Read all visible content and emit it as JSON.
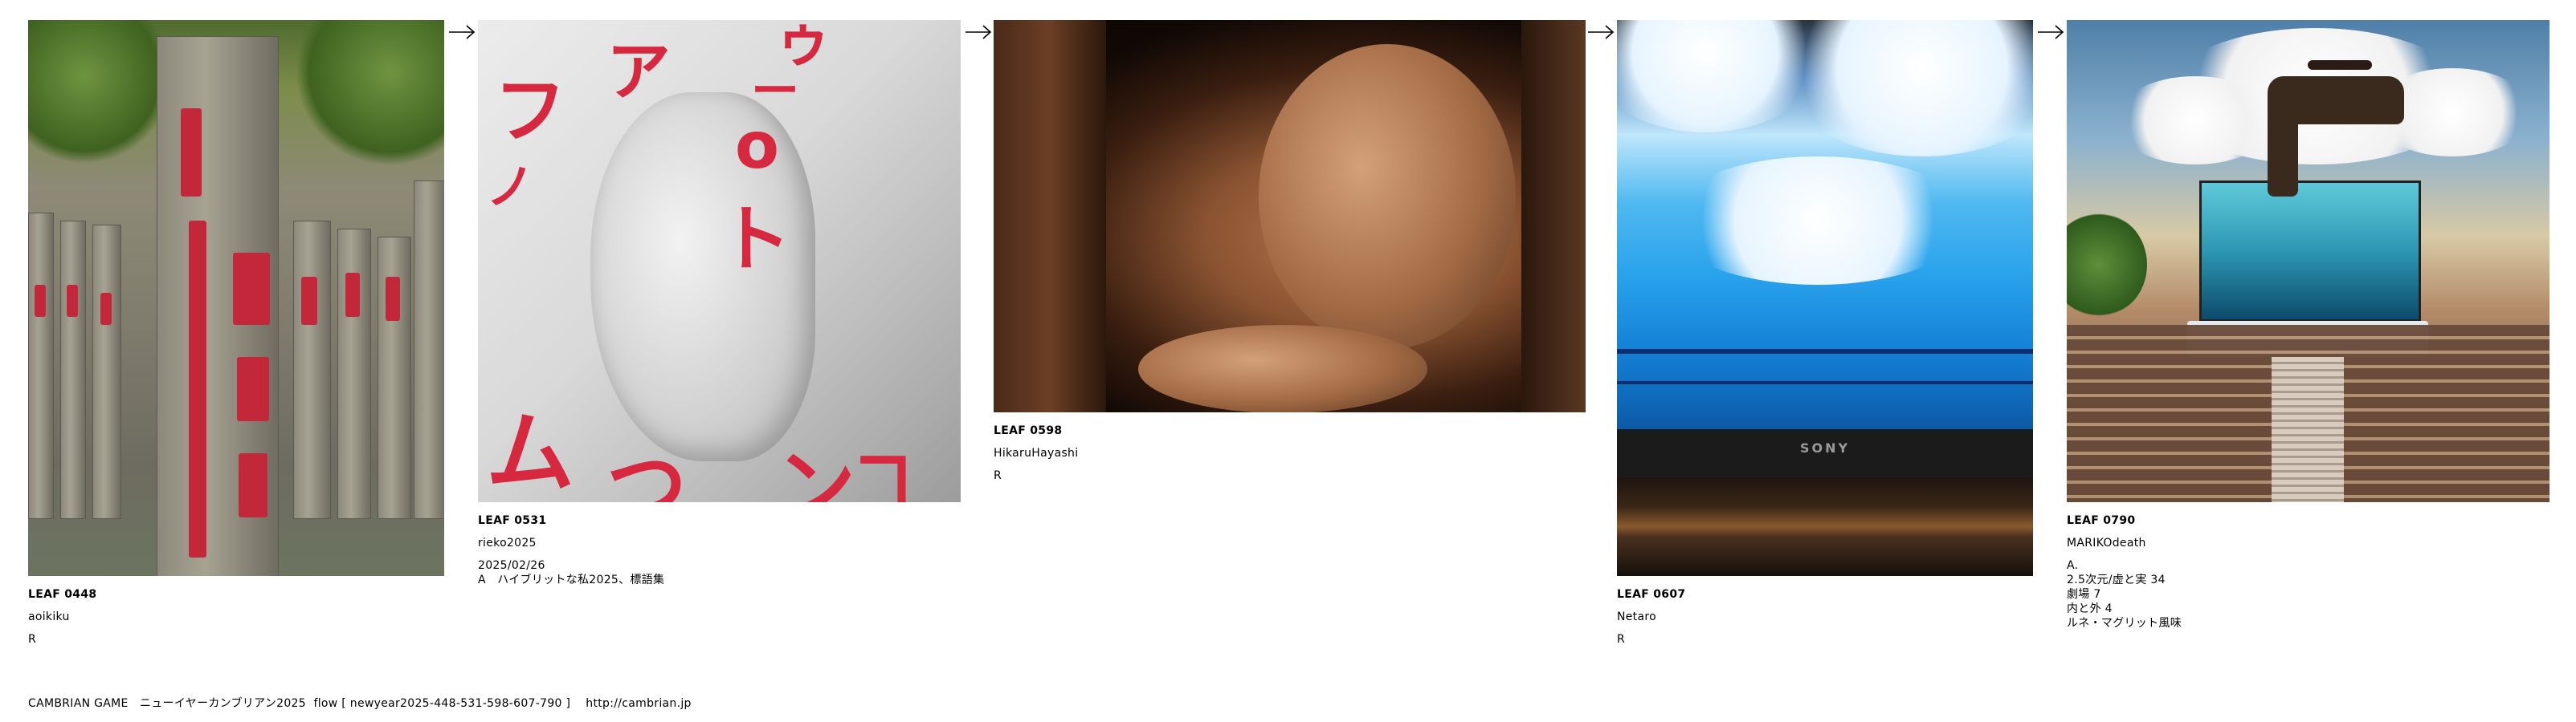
{
  "leaves": [
    {
      "code": "LEAF 0448",
      "user": "aoikiku",
      "lines": [
        "R"
      ]
    },
    {
      "code": "LEAF 0531",
      "user": "rieko2025",
      "lines": [
        "2025/02/26",
        "A　ハイブリットな私2025、標語集"
      ]
    },
    {
      "code": "LEAF 0598",
      "user": "HikaruHayashi",
      "lines": [
        "R"
      ]
    },
    {
      "code": "LEAF 0607",
      "user": "Netaro",
      "lines": [
        "R"
      ]
    },
    {
      "code": "LEAF 0790",
      "user": "MARIKOdeath",
      "lines": [
        "A.",
        "2.5次元/虚と実 34",
        "劇場 7",
        "内と外 4",
        "ルネ・マグリット風味"
      ]
    }
  ],
  "arrow_glyph": "→",
  "tv_brand": "SONY",
  "footer": "CAMBRIAN GAME　ニューイヤーカンブリアン2025  flow [ newyear2025-448-531-598-607-790 ]　 http://cambrian.jp",
  "icons": [
    "arrow-right-icon"
  ],
  "colors": {
    "background": "#ffffff",
    "text": "#000000"
  }
}
